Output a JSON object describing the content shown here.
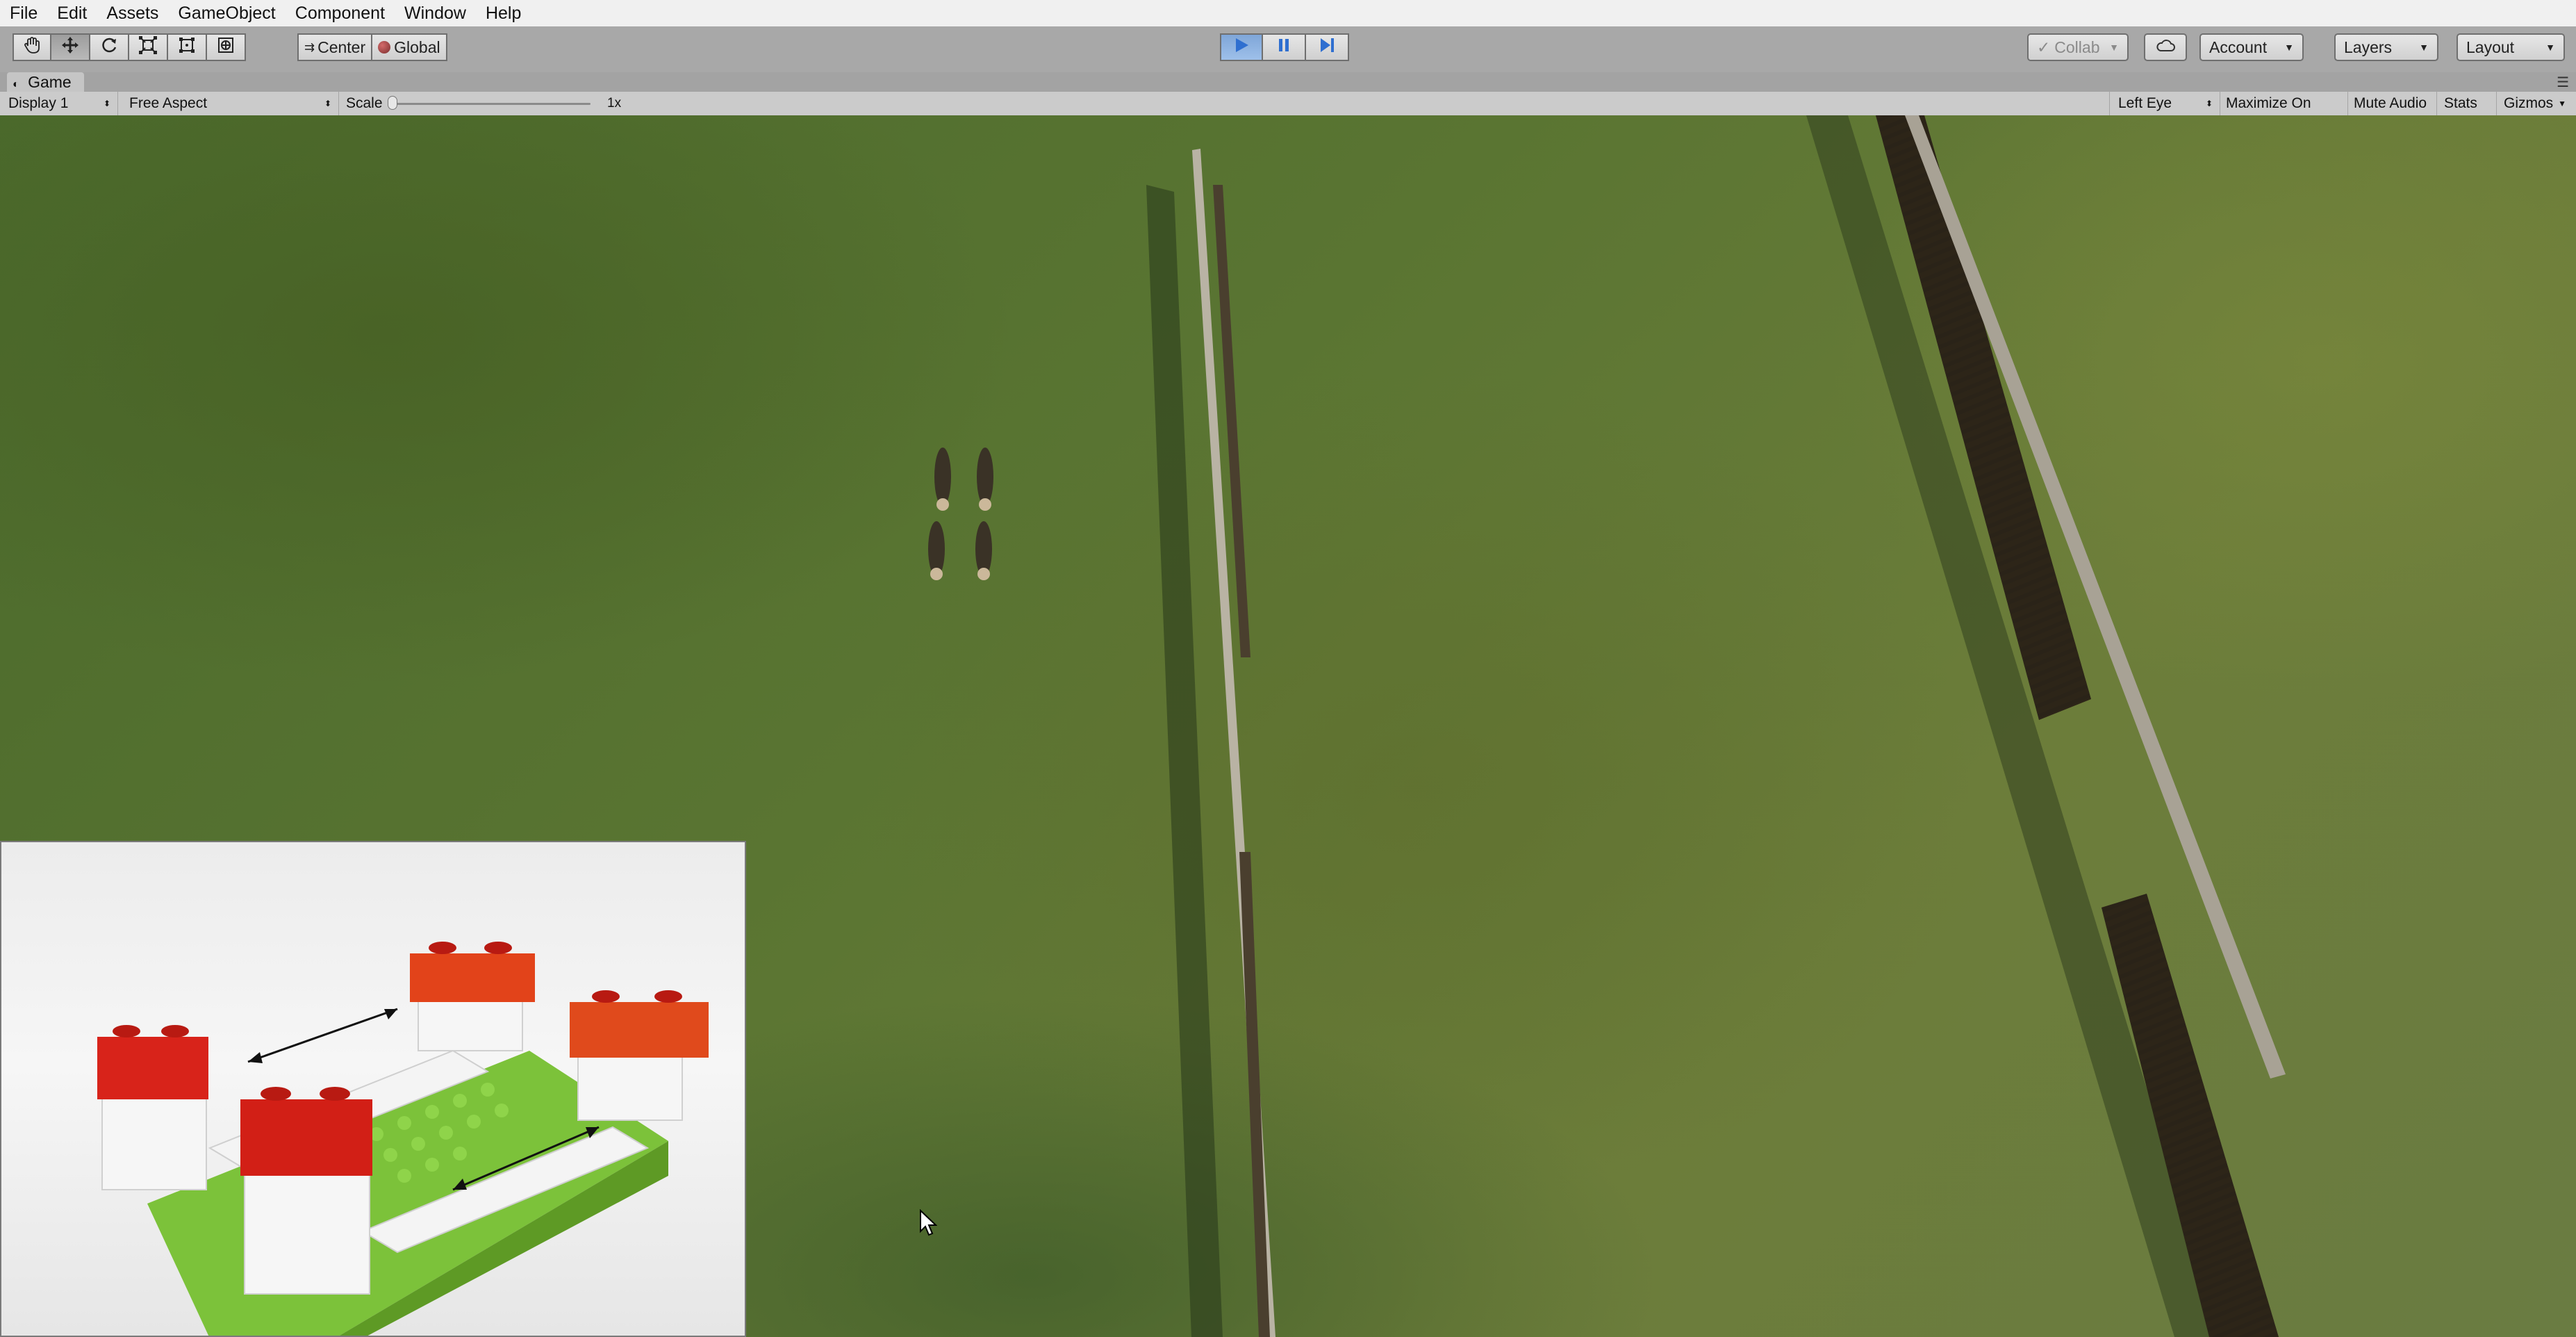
{
  "menu": [
    "File",
    "Edit",
    "Assets",
    "GameObject",
    "Component",
    "Window",
    "Help"
  ],
  "toolbar": {
    "transform_tools": [
      "hand-tool",
      "move-tool",
      "rotate-tool",
      "scale-tool",
      "rect-tool",
      "transform-tool"
    ],
    "pivot_label": "Center",
    "space_label": "Global",
    "collab_label": "Collab",
    "account_label": "Account",
    "layers_label": "Layers",
    "layout_label": "Layout",
    "play_state": "playing",
    "accent_color": "#4a7fd0"
  },
  "game_tab": {
    "title": "Game"
  },
  "game_bar": {
    "display": "Display 1",
    "aspect": "Free Aspect",
    "scale_label": "Scale",
    "scale_value": "1x",
    "eye": "Left Eye",
    "maximize": "Maximize On Play",
    "mute": "Mute Audio",
    "stats": "Stats",
    "gizmos": "Gizmos"
  }
}
